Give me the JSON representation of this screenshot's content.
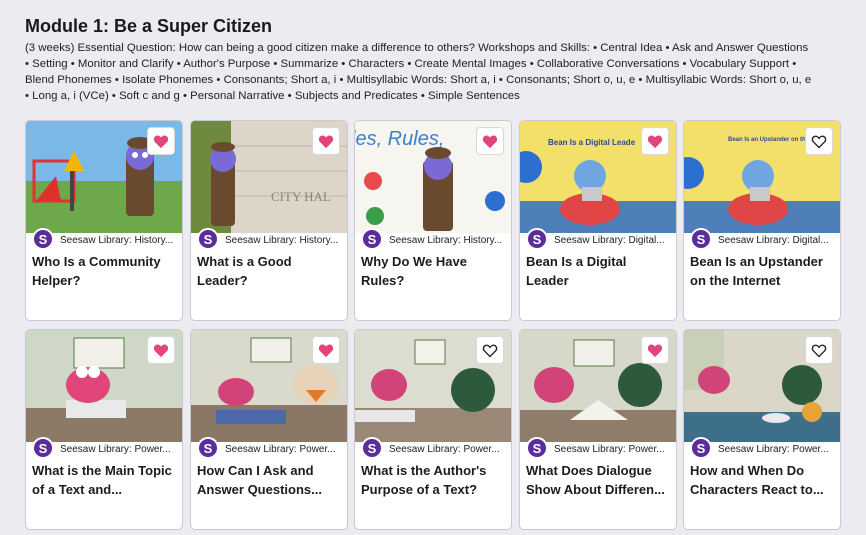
{
  "module": {
    "title": "Module 1: Be a Super Citizen",
    "description": "(3 weeks) Essential Question: How can being a good citizen make a difference to others? Workshops and Skills: • Central Idea • Ask and Answer Questions • Setting • Monitor and Clarify • Author's Purpose • Summarize • Characters • Create Mental Images • Collaborative Conversations • Vocabulary Support • Blend Phonemes • Isolate Phonemes • Consonants; Short a, i • Multisyllabic Words: Short a, i • Consonants; Short o, u, e • Multisyllabic Words: Short o, u, e • Long a, i (VCe) • Soft c and g • Personal Narrative • Subjects and Predicates • Simple Sentences"
  },
  "colors": {
    "accent": "#5b2d9a",
    "heart_filled": "#e0457b",
    "card_border": "#c9c9d2",
    "background": "#ececf0"
  },
  "logo_letter": "S",
  "cards": [
    {
      "title": "Who Is a Community Helper?",
      "source": "Seesaw Library: History...",
      "favorited": true,
      "thumb_text": ""
    },
    {
      "title": "What is a Good Leader?",
      "source": "Seesaw Library: History...",
      "favorited": true,
      "thumb_text": "CITY HAL"
    },
    {
      "title": "Why Do We Have Rules?",
      "source": "Seesaw Library: History...",
      "favorited": true,
      "thumb_text": "les, Rules,"
    },
    {
      "title": "Bean Is a Digital Leader",
      "source": "Seesaw Library: Digital...",
      "favorited": true,
      "thumb_text": "Bean Is a Digital Leade"
    },
    {
      "title": "Bean Is an Upstander on the Internet",
      "source": "Seesaw Library: Digital...",
      "favorited": false,
      "thumb_text": "Bean Is an Upstander on the Internet"
    },
    {
      "title": "What is the Main Topic of a Text and...",
      "source": "Seesaw Library: Power...",
      "favorited": true,
      "thumb_text": ""
    },
    {
      "title": "How Can I Ask and Answer Questions...",
      "source": "Seesaw Library: Power...",
      "favorited": true,
      "thumb_text": ""
    },
    {
      "title": "What is the Author's Purpose of a Text?",
      "source": "Seesaw Library: Power...",
      "favorited": false,
      "thumb_text": ""
    },
    {
      "title": "What Does Dialogue Show About Differen...",
      "source": "Seesaw Library: Power...",
      "favorited": true,
      "thumb_text": ""
    },
    {
      "title": "How and When Do Characters React to...",
      "source": "Seesaw Library: Power...",
      "favorited": false,
      "thumb_text": ""
    }
  ]
}
